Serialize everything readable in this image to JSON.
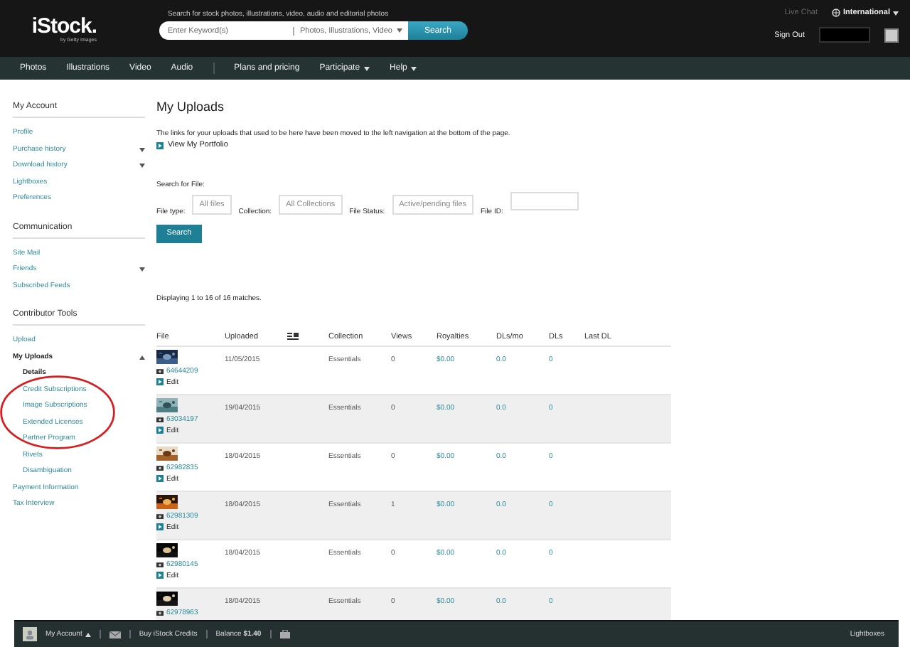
{
  "header": {
    "logo": "iStock.",
    "logo_sub": "by Getty Images",
    "search_caption": "Search for stock photos, illustrations, video, audio and editorial photos",
    "search_placeholder": "Enter Keyword(s)",
    "search_type": "Photos, Illustrations, Video",
    "search_button": "Search",
    "live_chat": "Live Chat",
    "region": "International",
    "sign_out": "Sign Out"
  },
  "nav": [
    {
      "label": "Photos",
      "dropdown": false
    },
    {
      "label": "Illustrations",
      "dropdown": false
    },
    {
      "label": "Video",
      "dropdown": false
    },
    {
      "label": "Audio",
      "dropdown": false
    },
    {
      "label": "Plans and pricing",
      "dropdown": false
    },
    {
      "label": "Participate",
      "dropdown": true
    },
    {
      "label": "Help",
      "dropdown": true
    }
  ],
  "sidebar": [
    {
      "title": "My Account",
      "items": [
        {
          "label": "Profile",
          "selected": false
        },
        {
          "label": "Purchase history",
          "expanded": false,
          "selected": false
        },
        {
          "label": "Download history",
          "expanded": false,
          "selected": false
        },
        {
          "label": "Lightboxes",
          "selected": false
        },
        {
          "label": "Preferences",
          "selected": false
        }
      ]
    },
    {
      "title": "Communication",
      "items": [
        {
          "label": "Site Mail",
          "selected": false
        },
        {
          "label": "Friends",
          "expanded": false,
          "selected": false
        },
        {
          "label": "Subscribed Feeds",
          "selected": false
        }
      ]
    },
    {
      "title": "Contributor Tools",
      "items": [
        {
          "label": "Upload",
          "selected": false
        },
        {
          "label": "My Uploads",
          "expanded": true,
          "selected": false,
          "children": [
            {
              "label": "Details",
              "selected": true
            },
            {
              "label": "Credit Subscriptions",
              "selected": false
            },
            {
              "label": "Image Subscriptions",
              "selected": false
            },
            {
              "label": "Extended Licenses",
              "selected": false
            },
            {
              "label": "Partner Program",
              "selected": false
            },
            {
              "label": "Rivets",
              "selected": false
            },
            {
              "label": "Disambiguation",
              "selected": false
            }
          ]
        },
        {
          "label": "Payment Information",
          "selected": false
        },
        {
          "label": "Tax Interview",
          "selected": false
        }
      ]
    }
  ],
  "page_title": "My Uploads",
  "notice": "The links for your uploads that used to be here have been moved to the left navigation at the bottom of the page.",
  "portfolio_link": "View My Portfolio",
  "search_title": "Search for File:",
  "filters": [
    {
      "label": "File type:",
      "value": "All files"
    },
    {
      "label": "Collection:",
      "value": "All Collections"
    },
    {
      "label": "File Status:",
      "value": "Active/pending files"
    },
    {
      "label": "File ID:"
    }
  ],
  "search_button": "Search",
  "match_count": "Displaying 1 to 16 of 16 matches.",
  "table": {
    "columns": [
      "File",
      "Uploaded",
      "",
      "Collection",
      "Views",
      "Royalties",
      "DLs/mo",
      "DLs",
      "Last DL"
    ],
    "rows": [
      {
        "id": "64644209",
        "edit": "Edit",
        "uploaded": "11/05/2015",
        "collection": "Essentials",
        "views": "0",
        "royalties": "$0.00",
        "dls_mo": "0.0",
        "dls": "0"
      },
      {
        "id": "63034197",
        "edit": "Edit",
        "uploaded": "19/04/2015",
        "collection": "Essentials",
        "views": "0",
        "royalties": "$0.00",
        "dls_mo": "0.0",
        "dls": "0"
      },
      {
        "id": "62982835",
        "edit": "Edit",
        "uploaded": "18/04/2015",
        "collection": "Essentials",
        "views": "0",
        "royalties": "$0.00",
        "dls_mo": "0.0",
        "dls": "0"
      },
      {
        "id": "62981309",
        "edit": "Edit",
        "uploaded": "18/04/2015",
        "collection": "Essentials",
        "views": "1",
        "royalties": "$0.00",
        "dls_mo": "0.0",
        "dls": "0"
      },
      {
        "id": "62980145",
        "edit": "Edit",
        "uploaded": "18/04/2015",
        "collection": "Essentials",
        "views": "0",
        "royalties": "$0.00",
        "dls_mo": "0.0",
        "dls": "0"
      },
      {
        "id": "62978963",
        "uploaded": "18/04/2015",
        "collection": "Essentials",
        "views": "0",
        "royalties": "$0.00",
        "dls_mo": "0.0",
        "dls": "0"
      }
    ]
  },
  "bottom_bar": {
    "account": "My Account",
    "buy": "Buy iStock Credits",
    "balance": "Balance **$1.40**",
    "lightboxes": "Lightboxes"
  }
}
